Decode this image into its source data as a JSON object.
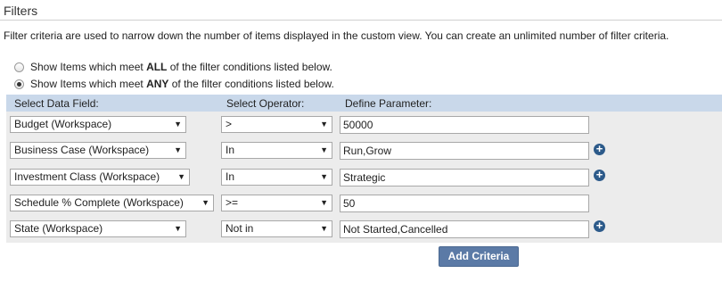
{
  "section": {
    "title": "Filters",
    "description": "Filter criteria are used to narrow down the number of items displayed in the custom view. You can create an unlimited number of filter criteria."
  },
  "match_mode": {
    "options": [
      {
        "prefix": "Show Items which meet ",
        "keyword": "ALL",
        "suffix": " of the filter conditions listed below.",
        "checked": false
      },
      {
        "prefix": "Show Items which meet ",
        "keyword": "ANY",
        "suffix": " of the filter conditions listed below.",
        "checked": true
      }
    ]
  },
  "grid": {
    "headers": {
      "field": "Select Data Field:",
      "operator": "Select Operator:",
      "parameter": "Define Parameter:"
    },
    "rows": [
      {
        "field": "Budget (Workspace)",
        "operator": ">",
        "parameter": "50000",
        "add_icon": false
      },
      {
        "field": "Business Case (Workspace)",
        "operator": "In",
        "parameter": "Run,Grow",
        "add_icon": true
      },
      {
        "field": "Investment Class (Workspace)",
        "operator": "In",
        "parameter": "Strategic",
        "add_icon": true
      },
      {
        "field": "Schedule % Complete (Workspace)",
        "operator": ">=",
        "parameter": "50",
        "add_icon": false
      },
      {
        "field": "State (Workspace)",
        "operator": "Not in",
        "parameter": "Not Started,Cancelled",
        "add_icon": true
      }
    ],
    "select_arrow_glyph": "▼",
    "add_icon_glyph": "+"
  },
  "actions": {
    "add_criteria_label": "Add Criteria"
  },
  "colors": {
    "header_band": "#c9d8ea",
    "grid_bg": "#ececec",
    "button_bg": "#5b7aa6",
    "add_icon": "#2c5a8a"
  }
}
